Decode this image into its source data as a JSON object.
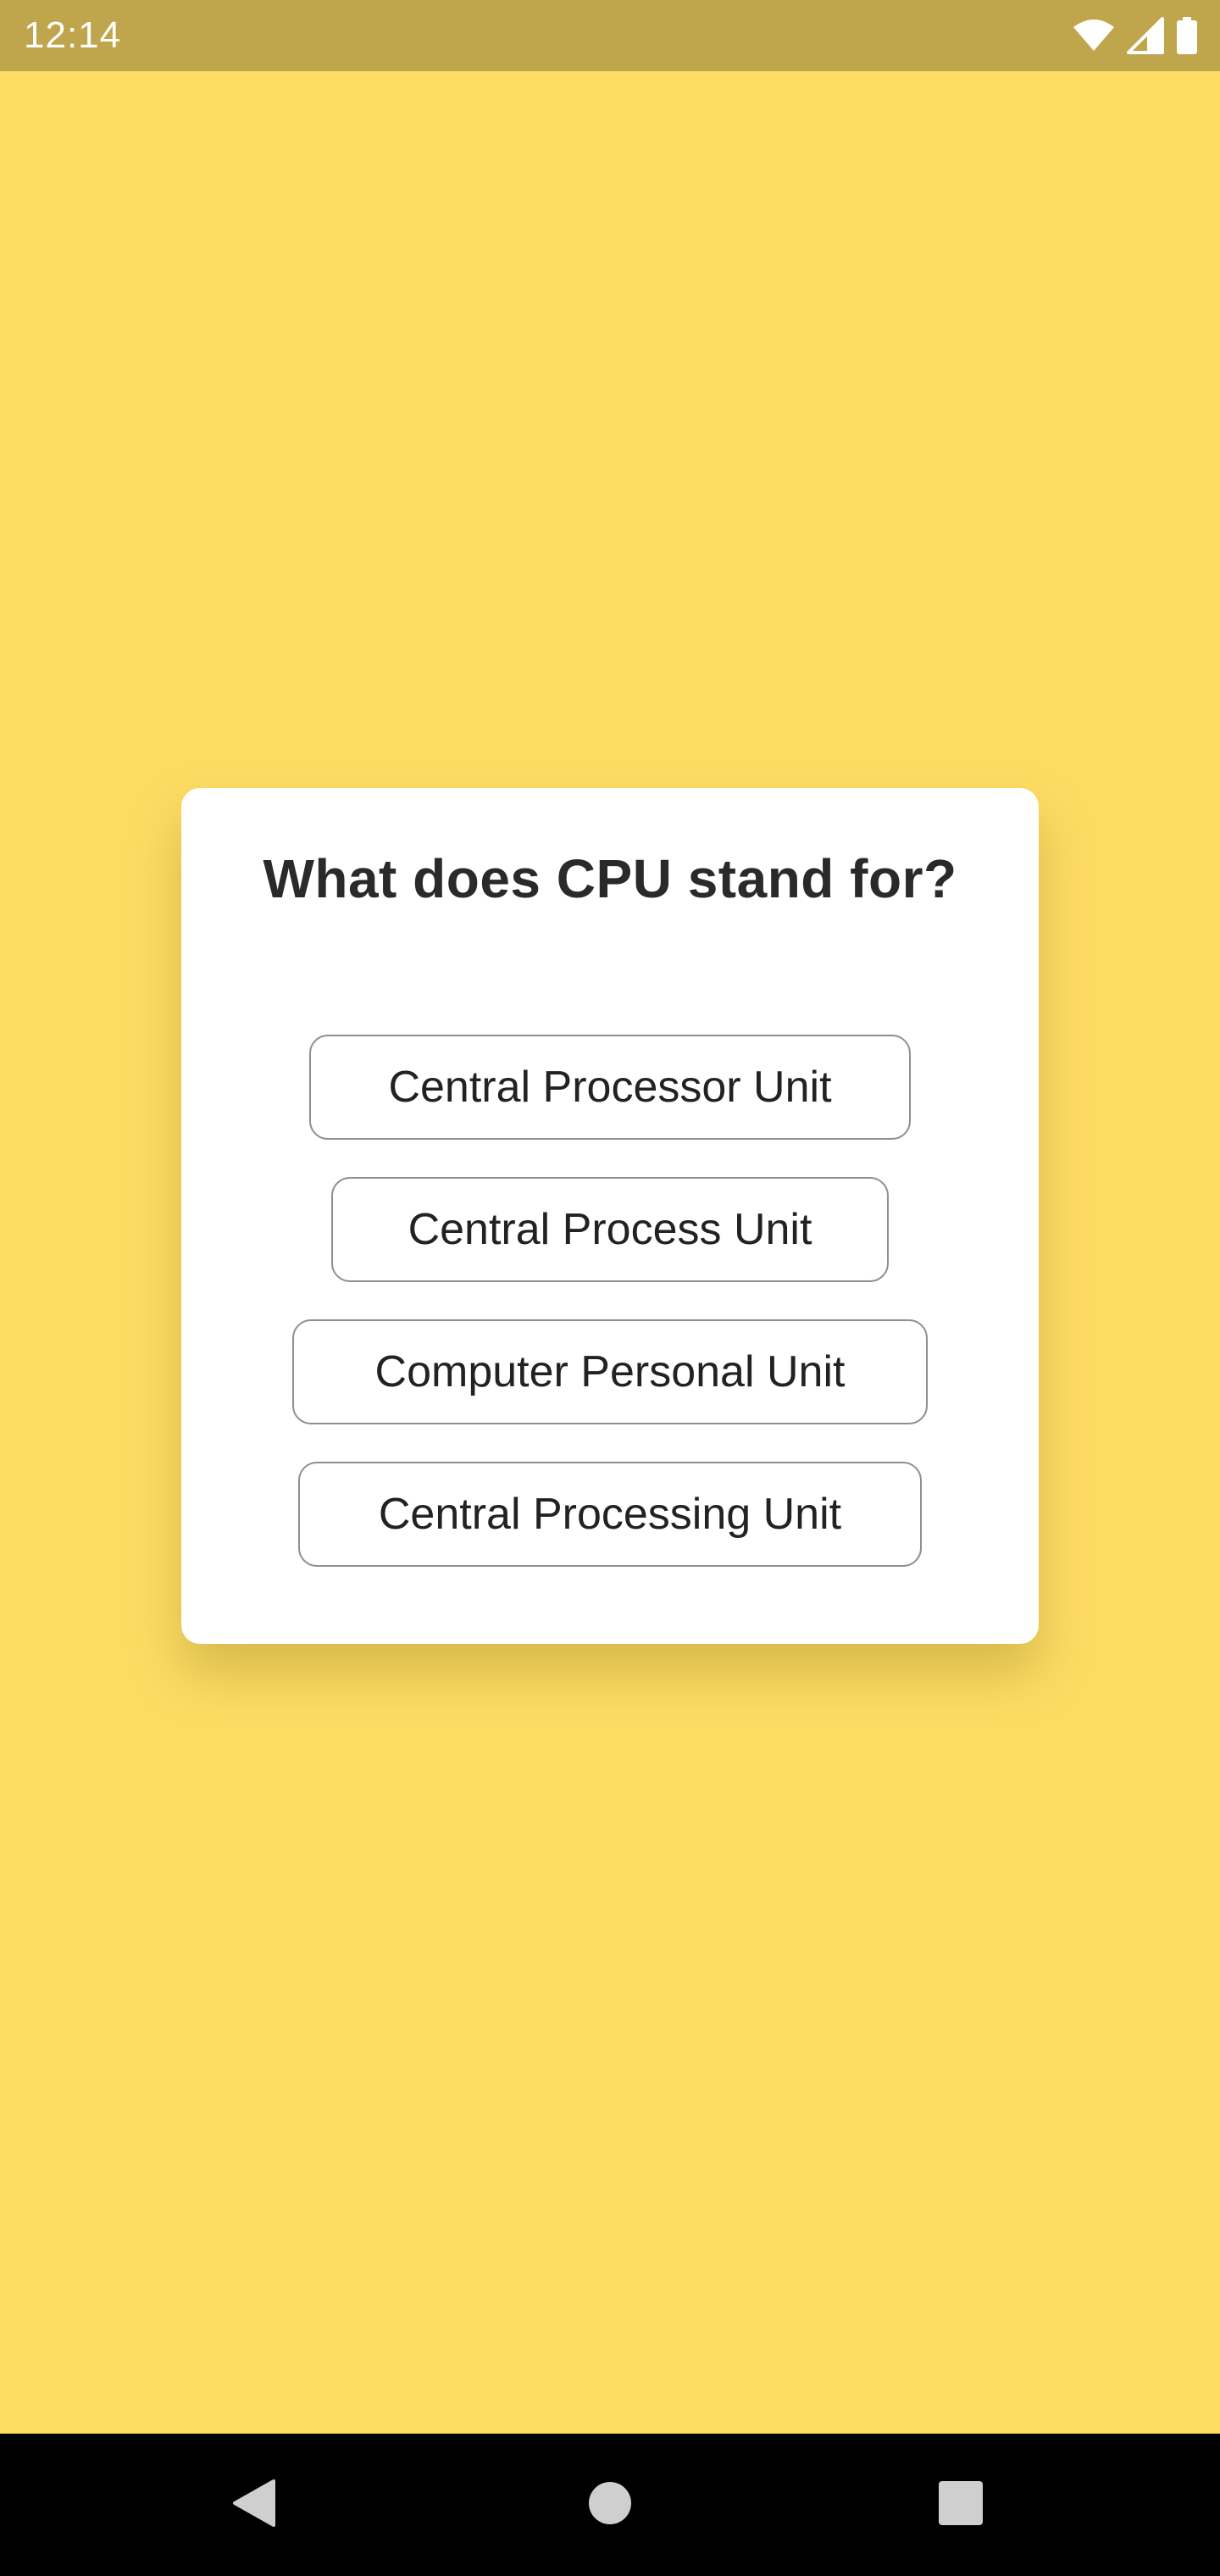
{
  "status_bar": {
    "time": "12:14",
    "icons": [
      "wifi-icon",
      "cell-signal-icon",
      "battery-icon"
    ],
    "background": "#BFA54B"
  },
  "screen": {
    "background": "#FDDC64"
  },
  "quiz": {
    "question": "What does CPU stand for?",
    "answers": [
      "Central Processor Unit",
      "Central Process Unit",
      "Computer Personal Unit",
      "Central Processing Unit"
    ]
  },
  "nav_bar": {
    "buttons": [
      "back-icon",
      "home-icon",
      "recents-icon"
    ],
    "background": "#000000"
  }
}
